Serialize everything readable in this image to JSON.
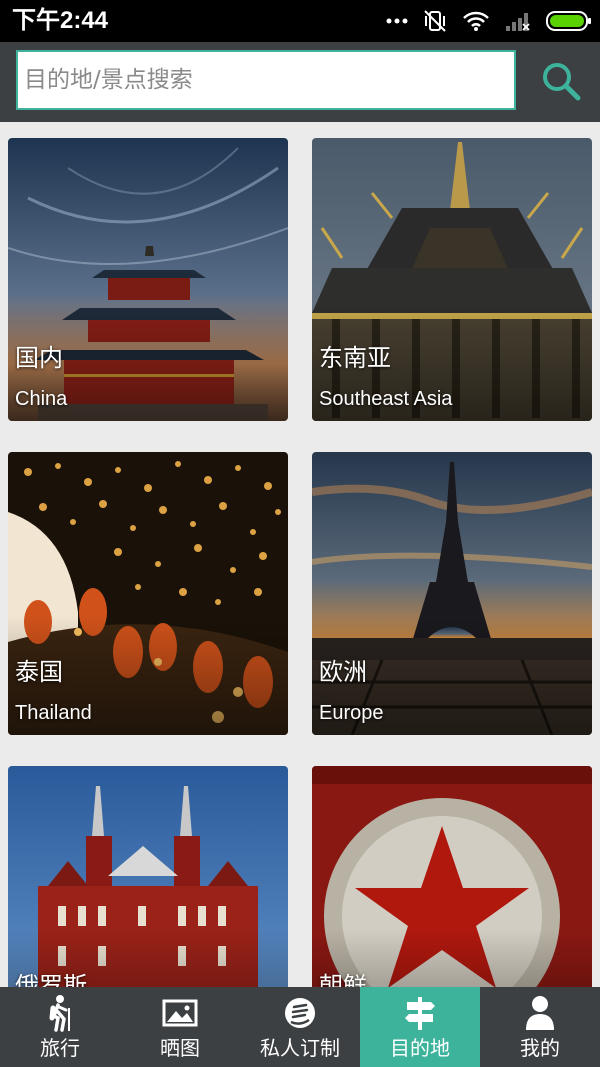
{
  "status_bar": {
    "time": "下午2:44"
  },
  "search": {
    "placeholder": "目的地/景点搜索",
    "value": ""
  },
  "destinations": [
    {
      "cn": "国内",
      "en": "China"
    },
    {
      "cn": "东南亚",
      "en": "Southeast Asia"
    },
    {
      "cn": "泰国",
      "en": "Thailand"
    },
    {
      "cn": "欧洲",
      "en": "Europe"
    },
    {
      "cn": "俄罗斯",
      "en": ""
    },
    {
      "cn": "朝鲜",
      "en": ""
    }
  ],
  "bottom_nav": {
    "items": [
      {
        "label": "旅行",
        "icon": "hiker-icon"
      },
      {
        "label": "晒图",
        "icon": "image-icon"
      },
      {
        "label": "私人订制",
        "icon": "custom-icon"
      },
      {
        "label": "目的地",
        "icon": "signpost-icon",
        "active": true
      },
      {
        "label": "我的",
        "icon": "person-icon"
      }
    ]
  },
  "colors": {
    "accent": "#3db39c",
    "header_bg": "#3c4043",
    "page_bg": "#ebebeb"
  }
}
